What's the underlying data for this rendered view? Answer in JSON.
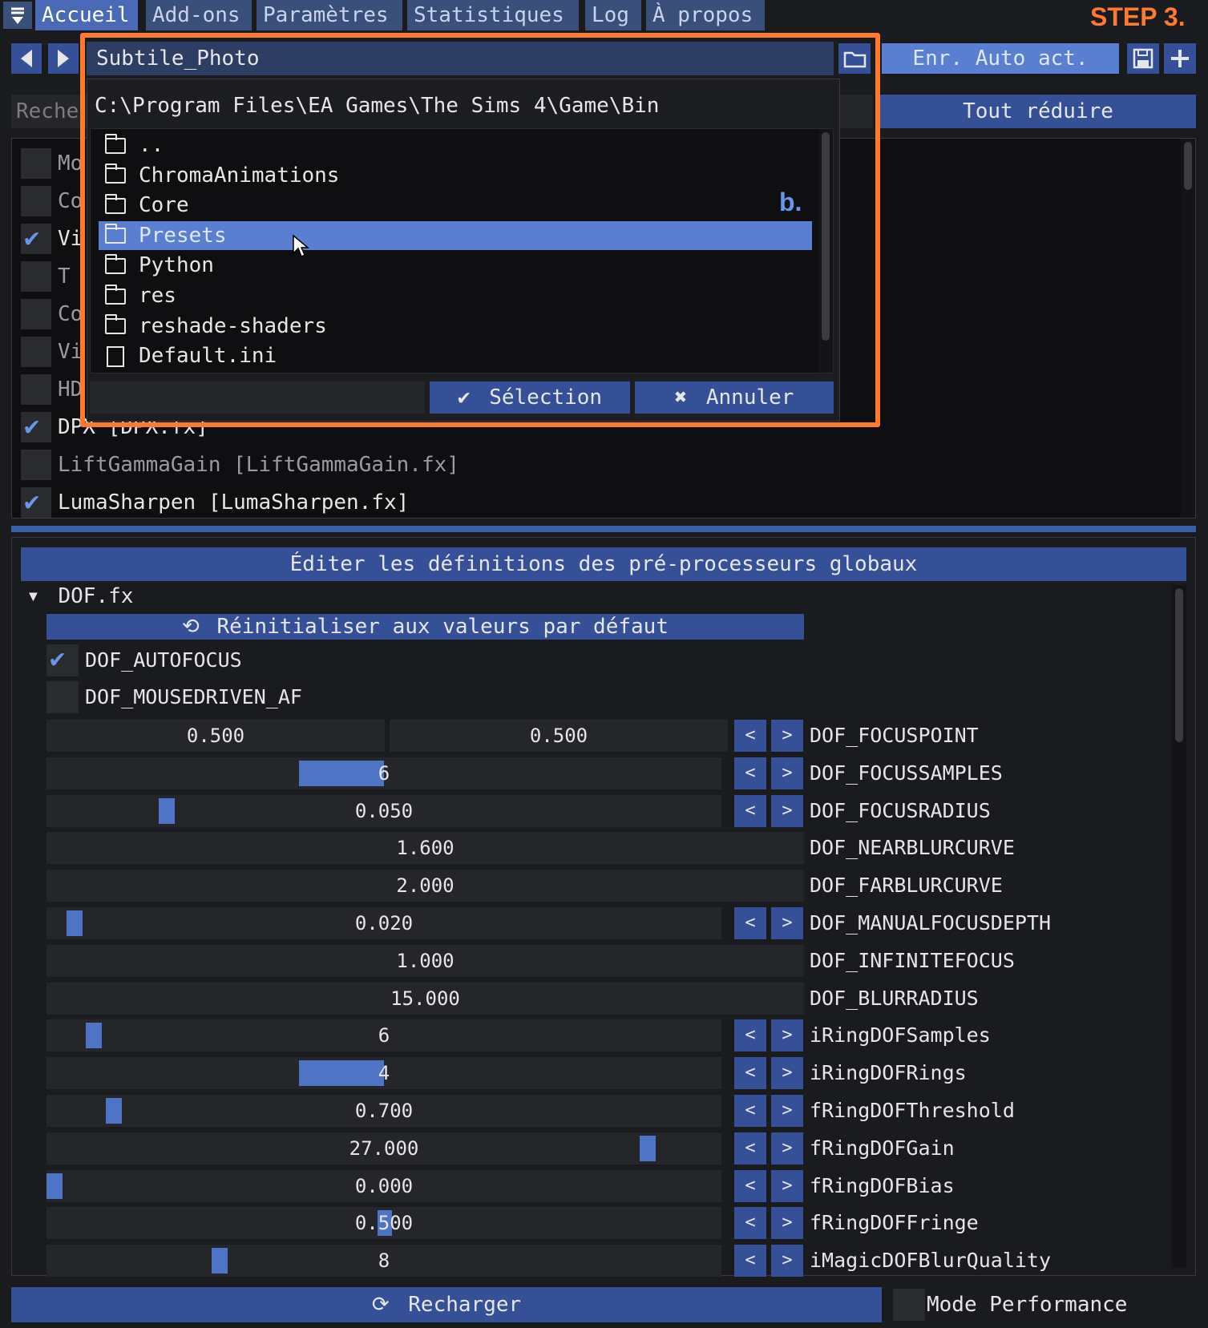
{
  "menu": {
    "toggle_icon": "caret-down-icon",
    "tabs": [
      "Accueil",
      "Add-ons",
      "Paramètres",
      "Statistiques",
      "Log",
      "À propos"
    ],
    "active_tab": "Accueil",
    "step_label": "STEP 3."
  },
  "preset_bar": {
    "prev_icon": "arrow-left-icon",
    "next_icon": "arrow-right-icon",
    "preset_name": "Subtile_Photo",
    "browse_icon": "folder-icon",
    "autosave_label": "Enr. Auto act.",
    "save_icon": "floppy-disk-icon",
    "add_icon": "plus-icon"
  },
  "search": {
    "placeholder": "Reche",
    "collapse_all_label": "Tout réduire"
  },
  "effects": [
    {
      "name": "Monochrome [Monochrome.fx]",
      "label_visible": "Mo",
      "enabled": false
    },
    {
      "name": "ColorMatrix [ColorMatrix.fx]",
      "label_visible": "Co",
      "enabled": false
    },
    {
      "name": "Vi",
      "label_visible": "Vi",
      "enabled": true
    },
    {
      "name": "Tonemap [Tonemap.fx]",
      "label_visible": "T",
      "enabled": false
    },
    {
      "name": "Colourfulness [Colourfulness.fx]",
      "label_visible": "Co",
      "enabled": false
    },
    {
      "name": "Vignette [Vignette.fx]",
      "label_visible": "Vi",
      "enabled": false
    },
    {
      "name": "HDR",
      "label_visible": "HD",
      "enabled": false
    },
    {
      "name": "DPX [DPX.fx]",
      "label_visible": "DPX [DPX.fx]",
      "enabled": true
    },
    {
      "name": "LiftGammaGain [LiftGammaGain.fx]",
      "label_visible": "LiftGammaGain [LiftGammaGain.fx]",
      "enabled": false
    },
    {
      "name": "LumaSharpen [LumaSharpen.fx]",
      "label_visible": "LumaSharpen [LumaSharpen.fx]",
      "enabled": true
    }
  ],
  "effects_ghost_text": [
    "Monochrome [Monochrome.fx]",
    "ColorMatrix [ColorMatrix.fx]",
    "Tonemap [Tonemap.fx]",
    "Colourfulness [Colourfulness.fx]",
    "Vignette [Vignette.fx]"
  ],
  "file_dialog": {
    "path": "C:\\Program Files\\EA Games\\The Sims 4\\Game\\Bin",
    "annotation": "b.",
    "items": [
      {
        "name": "..",
        "type": "folder"
      },
      {
        "name": "ChromaAnimations",
        "type": "folder"
      },
      {
        "name": "Core",
        "type": "folder"
      },
      {
        "name": "Presets",
        "type": "folder",
        "selected": true
      },
      {
        "name": "Python",
        "type": "folder"
      },
      {
        "name": "res",
        "type": "folder"
      },
      {
        "name": "reshade-shaders",
        "type": "folder"
      },
      {
        "name": "Default.ini",
        "type": "file"
      }
    ],
    "filename_value": "",
    "select_label": "Sélection",
    "cancel_label": "Annuler",
    "select_icon": "checkmark-icon",
    "cancel_icon": "x-icon",
    "highlight_color": "#ff7a2f"
  },
  "preprocessor": {
    "header": "Éditer les définitions des pré-processeurs globaux",
    "section": "DOF.fx",
    "reset_label": "Réinitialiser aux valeurs par défaut",
    "checkboxes": [
      {
        "label": "DOF_AUTOFOCUS",
        "checked": true
      },
      {
        "label": "DOF_MOUSEDRIVEN_AF",
        "checked": false
      }
    ],
    "params": [
      {
        "label": "DOF_FOCUSPOINT",
        "values": [
          "0.500",
          "0.500"
        ],
        "arrows": true
      },
      {
        "label": "DOF_FOCUSSAMPLES",
        "value": "6",
        "fill": 0.5,
        "arrows": true
      },
      {
        "label": "DOF_FOCUSRADIUS",
        "value": "0.050",
        "fill": 0.17,
        "arrows": true
      },
      {
        "label": "DOF_NEARBLURCURVE",
        "value": "1.600",
        "arrows": false
      },
      {
        "label": "DOF_FARBLURCURVE",
        "value": "2.000",
        "arrows": false
      },
      {
        "label": "DOF_MANUALFOCUSDEPTH",
        "value": "0.020",
        "fill": 0.03,
        "arrows": true
      },
      {
        "label": "DOF_INFINITEFOCUS",
        "value": "1.000",
        "arrows": false
      },
      {
        "label": "DOF_BLURRADIUS",
        "value": "15.000",
        "arrows": false
      },
      {
        "label": "iRingDOFSamples",
        "value": "6",
        "fill": 0.06,
        "arrows": true
      },
      {
        "label": "iRingDOFRings",
        "value": "4",
        "fill": 0.5,
        "arrows": true
      },
      {
        "label": "fRingDOFThreshold",
        "value": "0.700",
        "fill": 0.09,
        "arrows": true
      },
      {
        "label": "fRingDOFGain",
        "value": "27.000",
        "fill": 0.9,
        "arrows": true
      },
      {
        "label": "fRingDOFBias",
        "value": "0.000",
        "fill": 0.0,
        "arrows": true
      },
      {
        "label": "fRingDOFFringe",
        "value": "0.500",
        "fill": 0.5,
        "arrows": true
      },
      {
        "label": "iMagicDOFBlurQuality",
        "value": "8",
        "fill": 0.25,
        "arrows": true
      }
    ]
  },
  "footer": {
    "reload_label": "Recharger",
    "reload_icon": "refresh-icon",
    "perf_mode_label": "Mode Performance",
    "perf_mode_checked": false
  },
  "colors": {
    "accent": "#4a6ab8",
    "button": "#355096",
    "check": "#6b95e8",
    "highlight": "#ff7a2f"
  }
}
